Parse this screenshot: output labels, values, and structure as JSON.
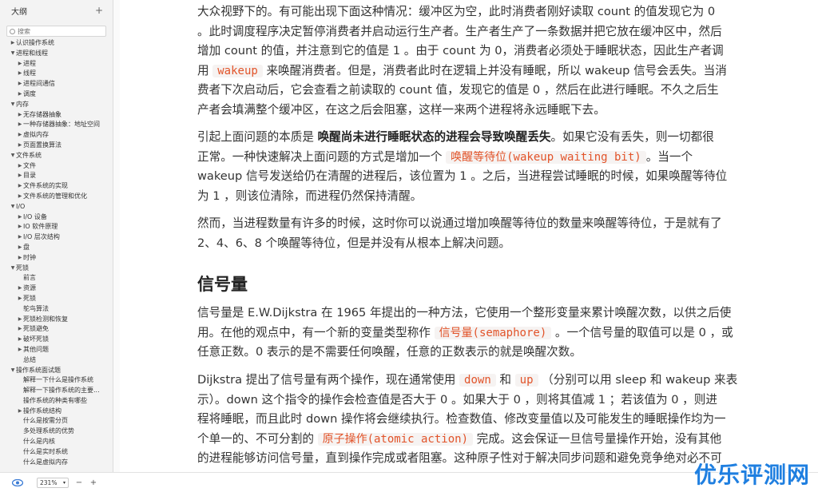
{
  "sidebar": {
    "title": "大纲",
    "add_label": "+",
    "search_placeholder": "搜索",
    "items": [
      {
        "label": "认识操作系统",
        "level": 1,
        "arrow": "▶"
      },
      {
        "label": "进程和线程",
        "level": 1,
        "arrow": "▼"
      },
      {
        "label": "进程",
        "level": 2,
        "arrow": "▶"
      },
      {
        "label": "线程",
        "level": 2,
        "arrow": "▶"
      },
      {
        "label": "进程间通信",
        "level": 2,
        "arrow": "▶"
      },
      {
        "label": "调度",
        "level": 2,
        "arrow": "▶"
      },
      {
        "label": "内存",
        "level": 1,
        "arrow": "▼"
      },
      {
        "label": "无存储器抽象",
        "level": 2,
        "arrow": "▶"
      },
      {
        "label": "一种存储器抽象：地址空间",
        "level": 2,
        "arrow": "▶"
      },
      {
        "label": "虚拟内存",
        "level": 2,
        "arrow": "▶"
      },
      {
        "label": "页面置换算法",
        "level": 2,
        "arrow": "▶"
      },
      {
        "label": "文件系统",
        "level": 1,
        "arrow": "▼"
      },
      {
        "label": "文件",
        "level": 2,
        "arrow": "▶"
      },
      {
        "label": "目录",
        "level": 2,
        "arrow": "▶"
      },
      {
        "label": "文件系统的实现",
        "level": 2,
        "arrow": "▶"
      },
      {
        "label": "文件系统的管理和优化",
        "level": 2,
        "arrow": "▶"
      },
      {
        "label": "I/O",
        "level": 1,
        "arrow": "▼"
      },
      {
        "label": "I/O 设备",
        "level": 2,
        "arrow": "▶"
      },
      {
        "label": "IO 软件原理",
        "level": 2,
        "arrow": "▶"
      },
      {
        "label": "I/O 层次结构",
        "level": 2,
        "arrow": "▶"
      },
      {
        "label": "盘",
        "level": 2,
        "arrow": "▶"
      },
      {
        "label": "时钟",
        "level": 2,
        "arrow": "▶"
      },
      {
        "label": "死锁",
        "level": 1,
        "arrow": "▼"
      },
      {
        "label": "前言",
        "level": 2,
        "arrow": ""
      },
      {
        "label": "资源",
        "level": 2,
        "arrow": "▶"
      },
      {
        "label": "死锁",
        "level": 2,
        "arrow": "▶"
      },
      {
        "label": "鸵鸟算法",
        "level": 2,
        "arrow": ""
      },
      {
        "label": "死锁检测和恢复",
        "level": 2,
        "arrow": "▶"
      },
      {
        "label": "死锁避免",
        "level": 2,
        "arrow": "▶"
      },
      {
        "label": "破坏死锁",
        "level": 2,
        "arrow": "▶"
      },
      {
        "label": "其他问题",
        "level": 2,
        "arrow": "▶"
      },
      {
        "label": "总结",
        "level": 2,
        "arrow": ""
      },
      {
        "label": "操作系统面试题",
        "level": 1,
        "arrow": "▼"
      },
      {
        "label": "解释一下什么是操作系统",
        "level": 2,
        "arrow": ""
      },
      {
        "label": "解释一下操作系统的主要...",
        "level": 2,
        "arrow": ""
      },
      {
        "label": "操作系统的种类有哪些",
        "level": 2,
        "arrow": ""
      },
      {
        "label": "操作系统结构",
        "level": 2,
        "arrow": "▶"
      },
      {
        "label": "什么是按需分页",
        "level": 2,
        "arrow": ""
      },
      {
        "label": "多处理系统的优势",
        "level": 2,
        "arrow": ""
      },
      {
        "label": "什么是内核",
        "level": 2,
        "arrow": ""
      },
      {
        "label": "什么是实时系统",
        "level": 2,
        "arrow": ""
      },
      {
        "label": "什么是虚拟内存",
        "level": 2,
        "arrow": ""
      }
    ]
  },
  "bottombar": {
    "zoom": "231%",
    "minus": "−",
    "plus": "+"
  },
  "content": {
    "p1": {
      "l1": "大众视野下的。有可能出现下面这种情况：缓冲区为空，此时消费者刚好读取 count 的值发现它为 0",
      "l2": "。此时调度程序决定暂停消费者并启动运行生产者。生产者生产了一条数据并把它放在缓冲区中，然后",
      "l3": "增加 count 的值，并注意到它的值是 1 。由于 count 为 0，消费者必须处于睡眠状态，因此生产者调",
      "l4a": "用 ",
      "l4code": "wakeup",
      "l4b": " 来唤醒消费者。但是，消费者此时在逻辑上并没有睡眠，所以 wakeup 信号会丢失。当消",
      "l5": "费者下次启动后，它会查看之前读取的 count 值，发现它的值是 0 ，然后在此进行睡眠。不久之后生",
      "l6": "产者会填满整个缓冲区，在这之后会阻塞，这样一来两个进程将永远睡眠下去。"
    },
    "p2": {
      "l1a": "引起上面问题的本质是 ",
      "l1strong": "唤醒尚未进行睡眠状态的进程会导致唤醒丢失",
      "l1b": "。如果它没有丢失，则一切都很",
      "l2a": "正常。一种快速解决上面问题的方式是增加一个 ",
      "l2code": "唤醒等待位(wakeup waiting bit)",
      "l2b": "。当一个",
      "l3": "wakeup 信号发送给仍在清醒的进程后，该位置为 1 。之后，当进程尝试睡眠的时候，如果唤醒等待位",
      "l4": "为 1 ，则该位清除，而进程仍然保持清醒。"
    },
    "p3": {
      "l1": "然而，当进程数量有许多的时候，这时你可以说通过增加唤醒等待位的数量来唤醒等待位，于是就有了",
      "l2": "2、4、6、8 个唤醒等待位，但是并没有从根本上解决问题。"
    },
    "heading": "信号量",
    "p4": {
      "l1": "信号量是 E.W.Dijkstra 在 1965 年提出的一种方法，它使用一个整形变量来累计唤醒次数，以供之后使",
      "l2a": "用。在他的观点中，有一个新的变量类型称作 ",
      "l2code": "信号量(semaphore)",
      "l2b": " 。一个信号量的取值可以是 0 ，或",
      "l3": "任意正数。0 表示的是不需要任何唤醒，任意的正数表示的就是唤醒次数。"
    },
    "p5": {
      "l1a": "Dijkstra 提出了信号量有两个操作，现在通常使用 ",
      "l1code1": "down",
      "l1mid": " 和 ",
      "l1code2": "up",
      "l1b": " （分别可以用 sleep 和 wakeup 来表",
      "l2": "示）。down 这个指令的操作会检查值是否大于 0 。如果大于 0 ，则将其值减 1 ；若该值为 0 ，则进",
      "l3": "程将睡眠，而且此时 down 操作将会继续执行。检查数值、修改变量值以及可能发生的睡眠操作均为一",
      "l4a": "个单一的、不可分割的 ",
      "l4code": "原子操作(atomic action)",
      "l4b": " 完成。这会保证一旦信号量操作开始，没有其他",
      "l5": "的进程能够访问信号量，直到操作完成或者阻塞。这种原子性对于解决同步问题和避免竞争绝对必不可"
    }
  },
  "watermark": "优乐评测网",
  "watermark_sub": "www.ylpcw.com"
}
